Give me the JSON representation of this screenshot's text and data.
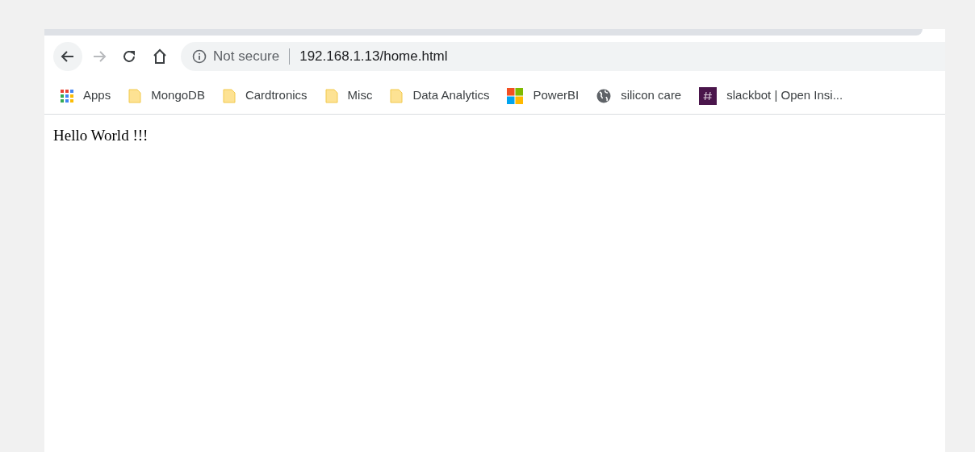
{
  "toolbar": {
    "security_label": "Not secure",
    "url": "192.168.1.13/home.html"
  },
  "bookmarks": [
    {
      "kind": "apps",
      "label": "Apps"
    },
    {
      "kind": "folder",
      "label": "MongoDB"
    },
    {
      "kind": "folder",
      "label": "Cardtronics"
    },
    {
      "kind": "folder",
      "label": "Misc"
    },
    {
      "kind": "folder",
      "label": "Data Analytics"
    },
    {
      "kind": "tiles",
      "label": "PowerBI"
    },
    {
      "kind": "globe",
      "label": "silicon care"
    },
    {
      "kind": "hash",
      "label": "slackbot | Open Insi..."
    }
  ],
  "page": {
    "text": "Hello World !!!"
  }
}
